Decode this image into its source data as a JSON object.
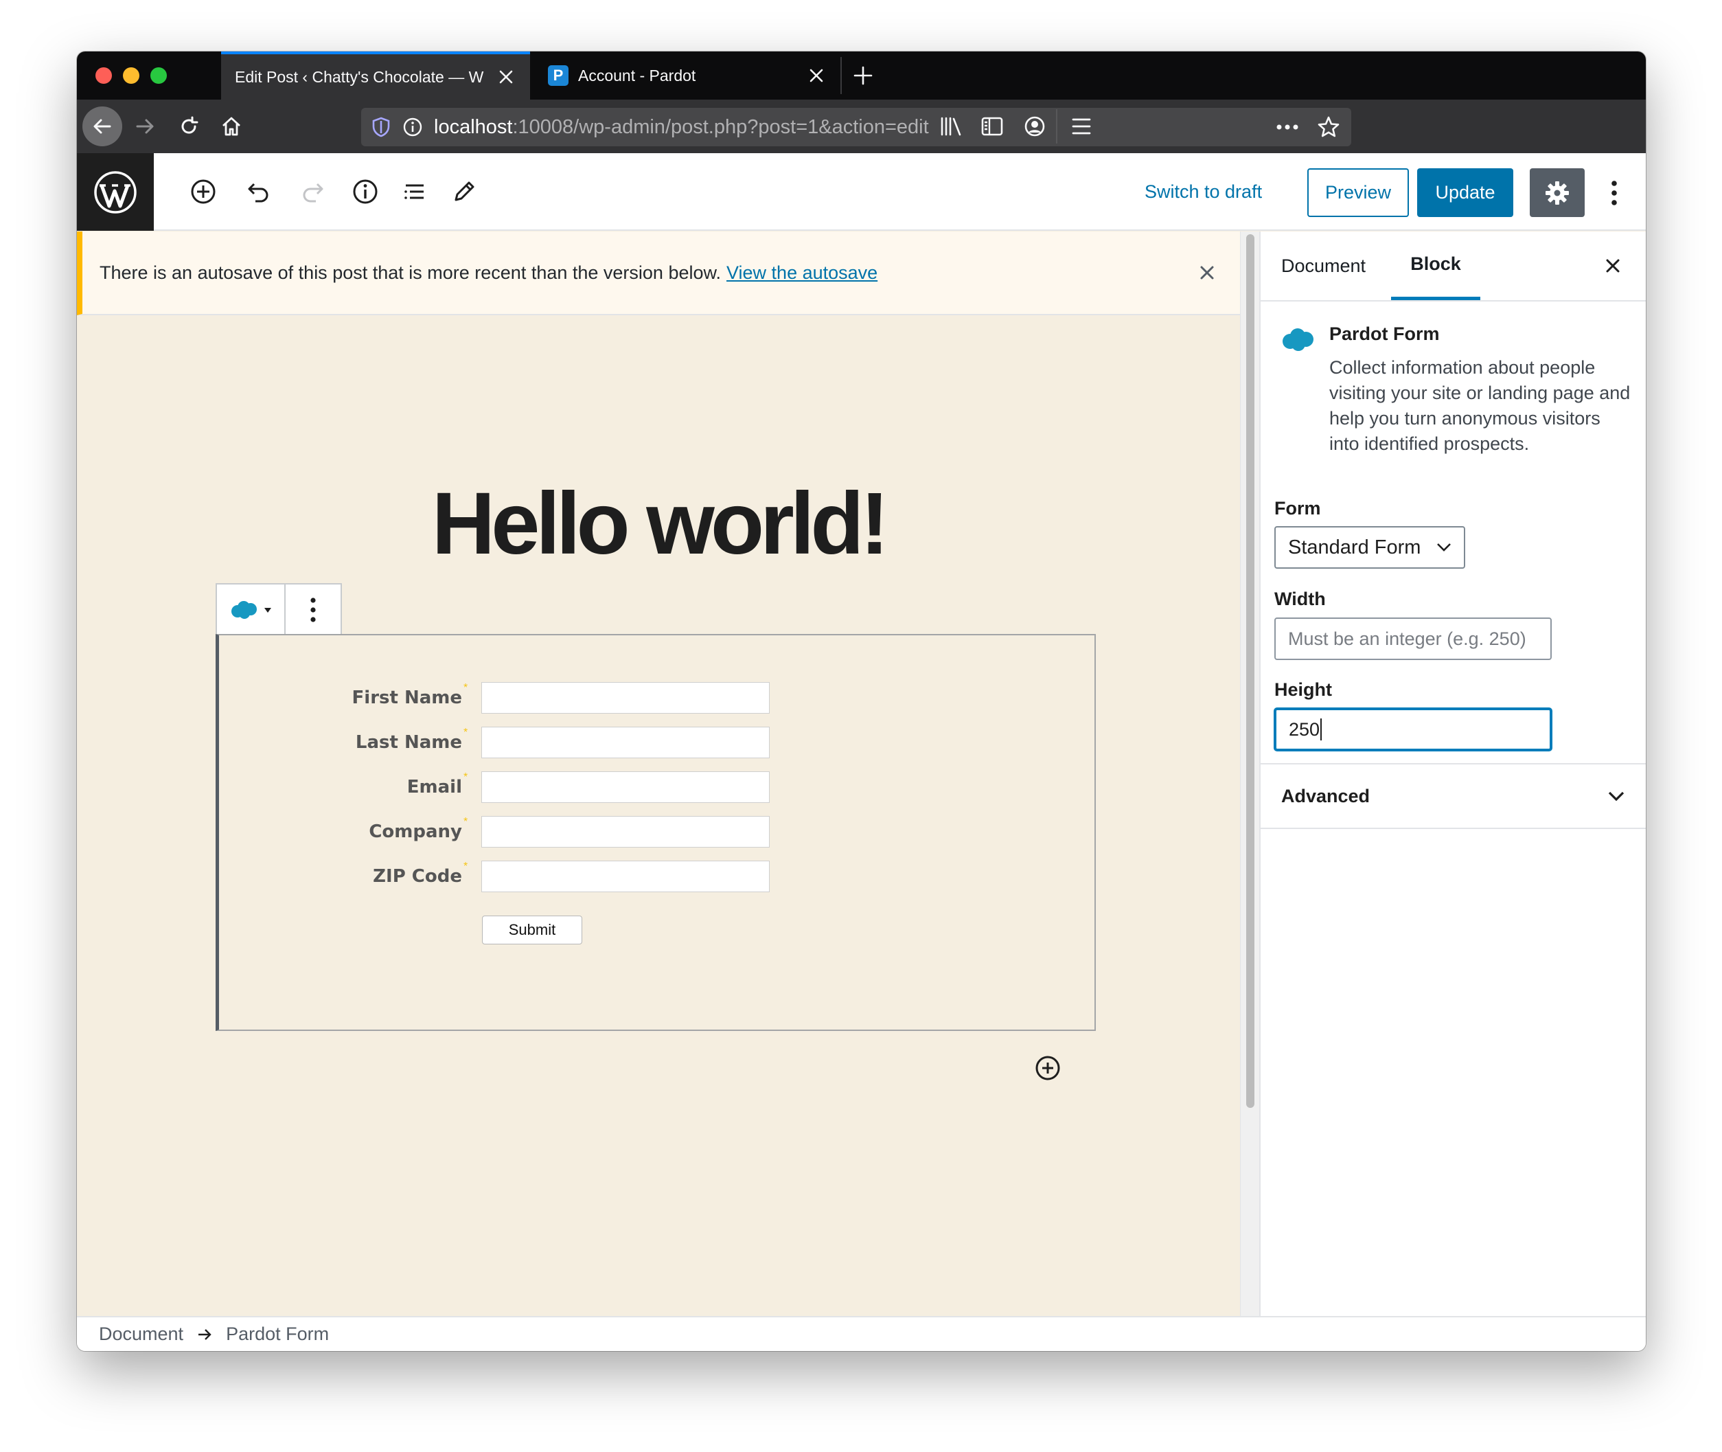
{
  "browser": {
    "tabs": [
      {
        "title": "Edit Post ‹ Chatty's Chocolate — W",
        "active": true
      },
      {
        "title": "Account - Pardot",
        "active": false,
        "favicon": "P"
      }
    ],
    "url": {
      "host": "localhost",
      "rest": ":10008/wp-admin/post.php?post=1&action=edit"
    }
  },
  "toolbar": {
    "switch_to_draft": "Switch to draft",
    "preview": "Preview",
    "update": "Update"
  },
  "notice": {
    "text": "There is an autosave of this post that is more recent than the version below.",
    "link": "View the autosave"
  },
  "post": {
    "title": "Hello world!"
  },
  "form": {
    "fields": [
      {
        "label": "First Name",
        "required_mark": "*"
      },
      {
        "label": "Last Name",
        "required_mark": "*"
      },
      {
        "label": "Email",
        "required_mark": "*"
      },
      {
        "label": "Company",
        "required_mark": "*"
      },
      {
        "label": "ZIP Code",
        "required_mark": "*"
      }
    ],
    "submit": "Submit"
  },
  "sidebar": {
    "tabs": {
      "document": "Document",
      "block": "Block"
    },
    "block_card": {
      "title": "Pardot Form",
      "description": "Collect information about people visiting your site or landing page and help you turn anonymous visitors into identified prospects."
    },
    "form_label": "Form",
    "form_value": "Standard Form",
    "width_label": "Width",
    "width_placeholder": "Must be an integer (e.g. 250)",
    "height_label": "Height",
    "height_value": "250",
    "advanced": "Advanced"
  },
  "breadcrumb": {
    "root": "Document",
    "current": "Pardot Form"
  },
  "colors": {
    "accent": "#0073aa",
    "canvas_bg": "#f5eee0",
    "notice_border": "#ffb900",
    "salesforce_blue": "#1798c1"
  }
}
